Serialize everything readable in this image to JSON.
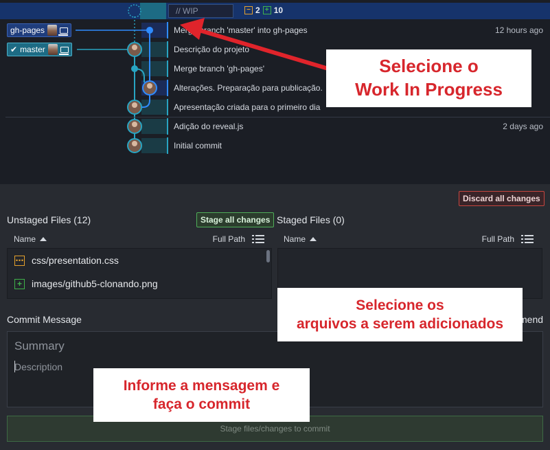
{
  "wip": {
    "placeholder": "// WIP",
    "modified_count": "2",
    "added_count": "10",
    "modified_symbol": "−",
    "added_symbol": "+"
  },
  "refs": {
    "gh_pages": "gh-pages",
    "master": "master",
    "check_symbol": "✔"
  },
  "commits": [
    {
      "message": "Merge branch 'master' into gh-pages",
      "time": "12 hours ago"
    },
    {
      "message": "Descrição do projeto",
      "time": ""
    },
    {
      "message": "Merge branch 'gh-pages'",
      "time": ""
    },
    {
      "message": "Alterações. Preparação para publicação.",
      "time": ""
    },
    {
      "message": "Apresentação criada para o primeiro dia",
      "time": ""
    },
    {
      "message": "Adição do reveal.js",
      "time": "2 days ago"
    },
    {
      "message": "Initial commit",
      "time": ""
    }
  ],
  "annotations": {
    "wip_line1": "Selecione o",
    "wip_line2": "Work In Progress",
    "files_line1": "Selecione os",
    "files_line2": "arquivos a serem adicionados",
    "commit_line1": "Informe a mensagem e",
    "commit_line2": "faça o commit"
  },
  "panel": {
    "discard_label": "Discard all changes",
    "unstaged_title": "Unstaged Files (12)",
    "stage_all_label": "Stage all changes",
    "staged_title": "Staged Files (0)",
    "col_name": "Name",
    "col_full_path": "Full Path",
    "unstaged_files": [
      {
        "name": "css/presentation.css",
        "status": "modified",
        "symbol": "⋯"
      },
      {
        "name": "images/github5-clonando.png",
        "status": "added",
        "symbol": "+"
      }
    ],
    "commit_message_label": "Commit Message",
    "amend_label": "mend",
    "summary_placeholder": "Summary",
    "description_placeholder": "Description",
    "commit_button_label": "Stage files/changes to commit"
  },
  "colors": {
    "annotation_text": "#d7262c",
    "annotation_arrow": "#e0242b",
    "graph_blue": "#2f8cff",
    "graph_teal": "#28a4c2"
  }
}
